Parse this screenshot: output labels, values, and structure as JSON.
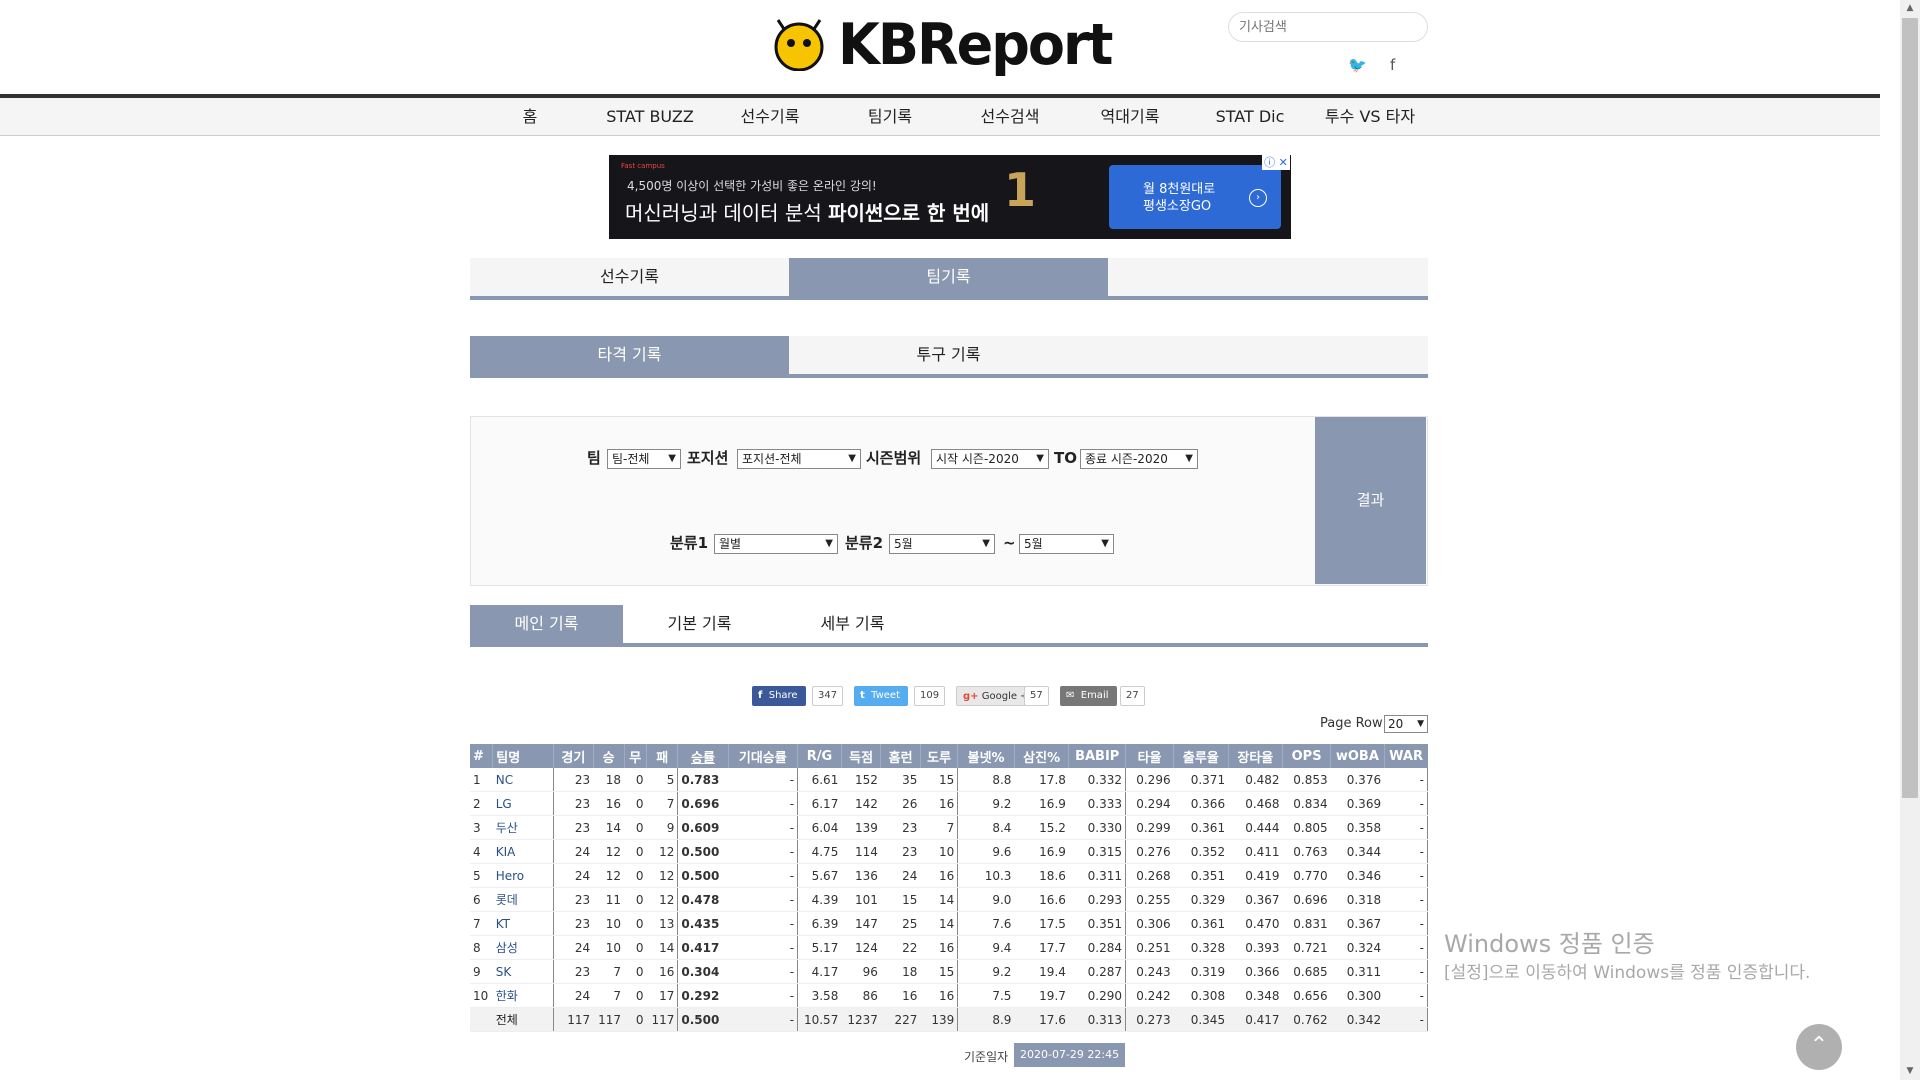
{
  "header": {
    "logo_text": "KBReport",
    "search_placeholder": "기사검색",
    "twitter_icon": "twitter-icon",
    "facebook_icon": "facebook-icon"
  },
  "nav": [
    "홈",
    "STAT BUZZ",
    "선수기록",
    "팀기록",
    "선수검색",
    "역대기록",
    "STAT Dic",
    "투수 VS 타자"
  ],
  "ad": {
    "brand": "Fast campus",
    "small_text": "4,500명 이상이 선택한 가성비 좋은 온라인 강의!",
    "big_text_a": "머신러닝과 데이터 분석 ",
    "big_text_b": "파이썬으로 한 번에",
    "rank": "1",
    "cta_line1": "월 8천원대로",
    "cta_line2": "평생소장GO",
    "close": "ⓘ ✕"
  },
  "tabs_main": [
    "선수기록",
    "팀기록"
  ],
  "tabs_sub": [
    "타격 기록",
    "투구 기록"
  ],
  "tabs_record": [
    "메인 기록",
    "기본 기록",
    "세부 기록"
  ],
  "filter": {
    "team_label": "팀",
    "team_value": "팀-전체",
    "position_label": "포지션",
    "position_value": "포지션-전체",
    "season_label": "시즌범위",
    "season_start": "시작 시즌-2020",
    "to_label": "TO",
    "season_end": "종료 시즌-2020",
    "cat1_label": "분류1",
    "cat1_value": "월별",
    "cat2_label": "분류2",
    "cat2_from": "5월",
    "tilde": "~",
    "cat2_to": "5월",
    "result_button": "결과"
  },
  "share": [
    {
      "label": "Share",
      "count": "347",
      "color": "#3b5998",
      "icon": "f"
    },
    {
      "label": "Tweet",
      "count": "109",
      "color": "#55acee",
      "icon": "t"
    },
    {
      "label": "Google +",
      "count": "57",
      "color": "#e8e8e8",
      "icon": "g+"
    },
    {
      "label": "Email",
      "count": "27",
      "color": "#777777",
      "icon": "✉"
    }
  ],
  "page_row": {
    "label": "Page Row",
    "value": "20"
  },
  "table": {
    "headers": [
      "#",
      "팀명",
      "경기",
      "승",
      "무",
      "패",
      "승률",
      "기대승률",
      "R/G",
      "득점",
      "홈런",
      "도루",
      "볼넷%",
      "삼진%",
      "BABIP",
      "타율",
      "출루율",
      "장타율",
      "OPS",
      "wOBA",
      "WAR"
    ],
    "rows": [
      [
        "1",
        "NC",
        "23",
        "18",
        "0",
        "5",
        "0.783",
        "-",
        "6.61",
        "152",
        "35",
        "15",
        "8.8",
        "17.8",
        "0.332",
        "0.296",
        "0.371",
        "0.482",
        "0.853",
        "0.376",
        "-"
      ],
      [
        "2",
        "LG",
        "23",
        "16",
        "0",
        "7",
        "0.696",
        "-",
        "6.17",
        "142",
        "26",
        "16",
        "9.2",
        "16.9",
        "0.333",
        "0.294",
        "0.366",
        "0.468",
        "0.834",
        "0.369",
        "-"
      ],
      [
        "3",
        "두산",
        "23",
        "14",
        "0",
        "9",
        "0.609",
        "-",
        "6.04",
        "139",
        "23",
        "7",
        "8.4",
        "15.2",
        "0.330",
        "0.299",
        "0.361",
        "0.444",
        "0.805",
        "0.358",
        "-"
      ],
      [
        "4",
        "KIA",
        "24",
        "12",
        "0",
        "12",
        "0.500",
        "-",
        "4.75",
        "114",
        "23",
        "10",
        "9.6",
        "16.9",
        "0.315",
        "0.276",
        "0.352",
        "0.411",
        "0.763",
        "0.344",
        "-"
      ],
      [
        "5",
        "Hero",
        "24",
        "12",
        "0",
        "12",
        "0.500",
        "-",
        "5.67",
        "136",
        "24",
        "16",
        "10.3",
        "18.6",
        "0.311",
        "0.268",
        "0.351",
        "0.419",
        "0.770",
        "0.346",
        "-"
      ],
      [
        "6",
        "롯데",
        "23",
        "11",
        "0",
        "12",
        "0.478",
        "-",
        "4.39",
        "101",
        "15",
        "14",
        "9.0",
        "16.6",
        "0.293",
        "0.255",
        "0.329",
        "0.367",
        "0.696",
        "0.318",
        "-"
      ],
      [
        "7",
        "KT",
        "23",
        "10",
        "0",
        "13",
        "0.435",
        "-",
        "6.39",
        "147",
        "25",
        "14",
        "7.6",
        "17.5",
        "0.351",
        "0.306",
        "0.361",
        "0.470",
        "0.831",
        "0.367",
        "-"
      ],
      [
        "8",
        "삼성",
        "24",
        "10",
        "0",
        "14",
        "0.417",
        "-",
        "5.17",
        "124",
        "22",
        "16",
        "9.4",
        "17.7",
        "0.284",
        "0.251",
        "0.328",
        "0.393",
        "0.721",
        "0.324",
        "-"
      ],
      [
        "9",
        "SK",
        "23",
        "7",
        "0",
        "16",
        "0.304",
        "-",
        "4.17",
        "96",
        "18",
        "15",
        "9.2",
        "19.4",
        "0.287",
        "0.243",
        "0.319",
        "0.366",
        "0.685",
        "0.311",
        "-"
      ],
      [
        "10",
        "한화",
        "24",
        "7",
        "0",
        "17",
        "0.292",
        "-",
        "3.58",
        "86",
        "16",
        "16",
        "7.5",
        "19.7",
        "0.290",
        "0.242",
        "0.308",
        "0.348",
        "0.656",
        "0.300",
        "-"
      ],
      [
        "",
        "전체",
        "117",
        "117",
        "0",
        "117",
        "0.500",
        "-",
        "10.57",
        "1237",
        "227",
        "139",
        "8.9",
        "17.6",
        "0.313",
        "0.273",
        "0.345",
        "0.417",
        "0.762",
        "0.342",
        "-"
      ]
    ]
  },
  "updated": {
    "label": "기준일자",
    "date": "2020-07-29 22:45"
  },
  "watermark": {
    "line1": "Windows 정품 인증",
    "line2": "[설정]으로 이동하여 Windows를 정품 인증합니다."
  },
  "colors": {
    "accent": "#8997b0",
    "link": "#2a4f88"
  }
}
